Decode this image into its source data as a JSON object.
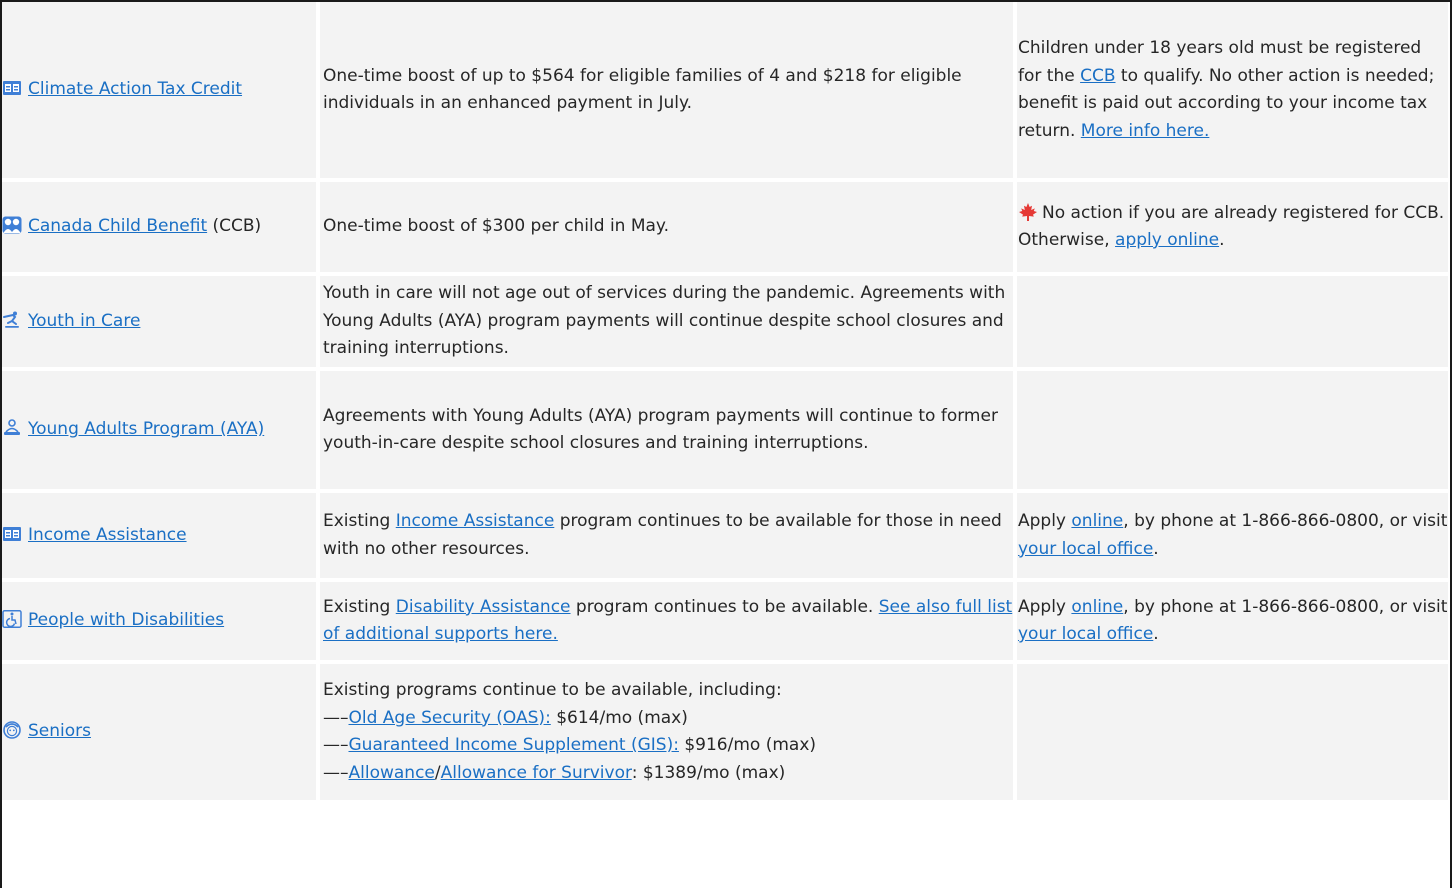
{
  "rows": [
    {
      "name": "Climate Action Tax Credit",
      "icon": "id-card-icon",
      "desc": "One-time boost of up to $564 for eligible families of 4 and $218 for eligible individuals in an enhanced payment in July.",
      "action": {
        "t1": "Children under 18 years old must be registered for the ",
        "l1": "CCB",
        "t2": " to qualify. No other action is needed; benefit is paid out according to your income tax return. ",
        "l2": "More info here."
      }
    },
    {
      "name": "Canada Child Benefit",
      "suffix": " (CCB)",
      "icon": "children-icon",
      "desc": "One-time boost of $300 per child in May.",
      "action": {
        "icon": "maple-leaf-icon",
        "t1": "No action if you are already registered for CCB. Otherwise, ",
        "l1": "apply online",
        "t2": "."
      }
    },
    {
      "name": "Youth in Care",
      "icon": "skateboarder-icon",
      "desc": "Youth in care will not age out of services during the pandemic. Agreements with Young Adults (AYA) program payments will continue despite school closures and training interruptions."
    },
    {
      "name": "Young Adults Program (AYA)",
      "icon": "person-at-desk-icon",
      "desc": "Agreements with Young Adults (AYA) program payments will continue to former youth-in-care despite school closures and training interruptions."
    },
    {
      "name": "Income Assistance",
      "icon": "id-card-icon",
      "desc": {
        "t1": "Existing ",
        "l1": "Income Assistance",
        "t2": " program continues to be available for those in need with no other resources."
      },
      "action": {
        "t1": "Apply ",
        "l1": "online",
        "t2": ", by phone at 1-866-866-0800, or visit ",
        "l2": "your local office",
        "t3": "."
      }
    },
    {
      "name": "People with Disabilities",
      "icon": "wheelchair-icon",
      "desc": {
        "t1": "Existing ",
        "l1": "Disability Assistance",
        "t2": " program continues to be available. ",
        "l2": "See also full list of additional supports here."
      },
      "action": {
        "t1": "Apply ",
        "l1": "online",
        "t2": ", by phone at 1-866-866-0800, or visit ",
        "l2": "your local office",
        "t3": "."
      }
    },
    {
      "name": "Seniors",
      "icon": "senior-face-icon",
      "desc": {
        "intro": "Existing programs continue to be available, including:",
        "dash": "—–",
        "oas_link": "Old Age Security (OAS):",
        "oas_amt": " $614/mo (max)",
        "gis_link": "Guaranteed Income Supplement (GIS):",
        "gis_amt": " $916/mo (max)",
        "allow_link": "Allowance",
        "slash": "/",
        "survivor_link": "Allowance for Survivor",
        "survivor_amt": ": $1389/mo (max)"
      }
    }
  ],
  "colors": {
    "link": "#1a6fc4",
    "cell_bg": "#f3f3f3",
    "icon_blue": "#3f7fd6",
    "leaf": "#e53935"
  }
}
